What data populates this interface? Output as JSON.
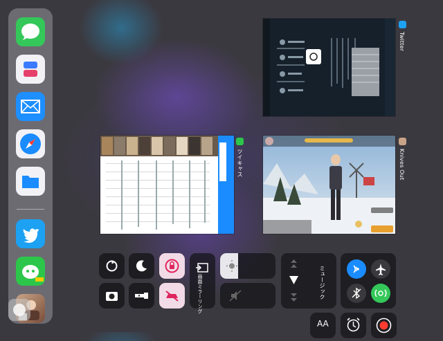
{
  "app_switcher": {
    "twitter_label": "Twitter",
    "game_label": "Knives Out",
    "tweet_app_label": "ツイキャス"
  },
  "control_center": {
    "screen_mirroring_label": "画面ミラーリング",
    "music_label": "ミュージック",
    "text_size_label": "AA"
  },
  "dock": {
    "apps": [
      "messages-icon",
      "shortcuts-icon",
      "mail-icon",
      "safari-icon",
      "files-icon",
      "twitter-icon",
      "game-chat-icon",
      "game-icon"
    ]
  },
  "colors": {
    "accent_blue": "#1a8cff",
    "twitter_blue": "#1da1f2",
    "messages_green": "#34c759",
    "record_red": "#ff3b30",
    "highlight_pink": "#ffb3c7"
  }
}
